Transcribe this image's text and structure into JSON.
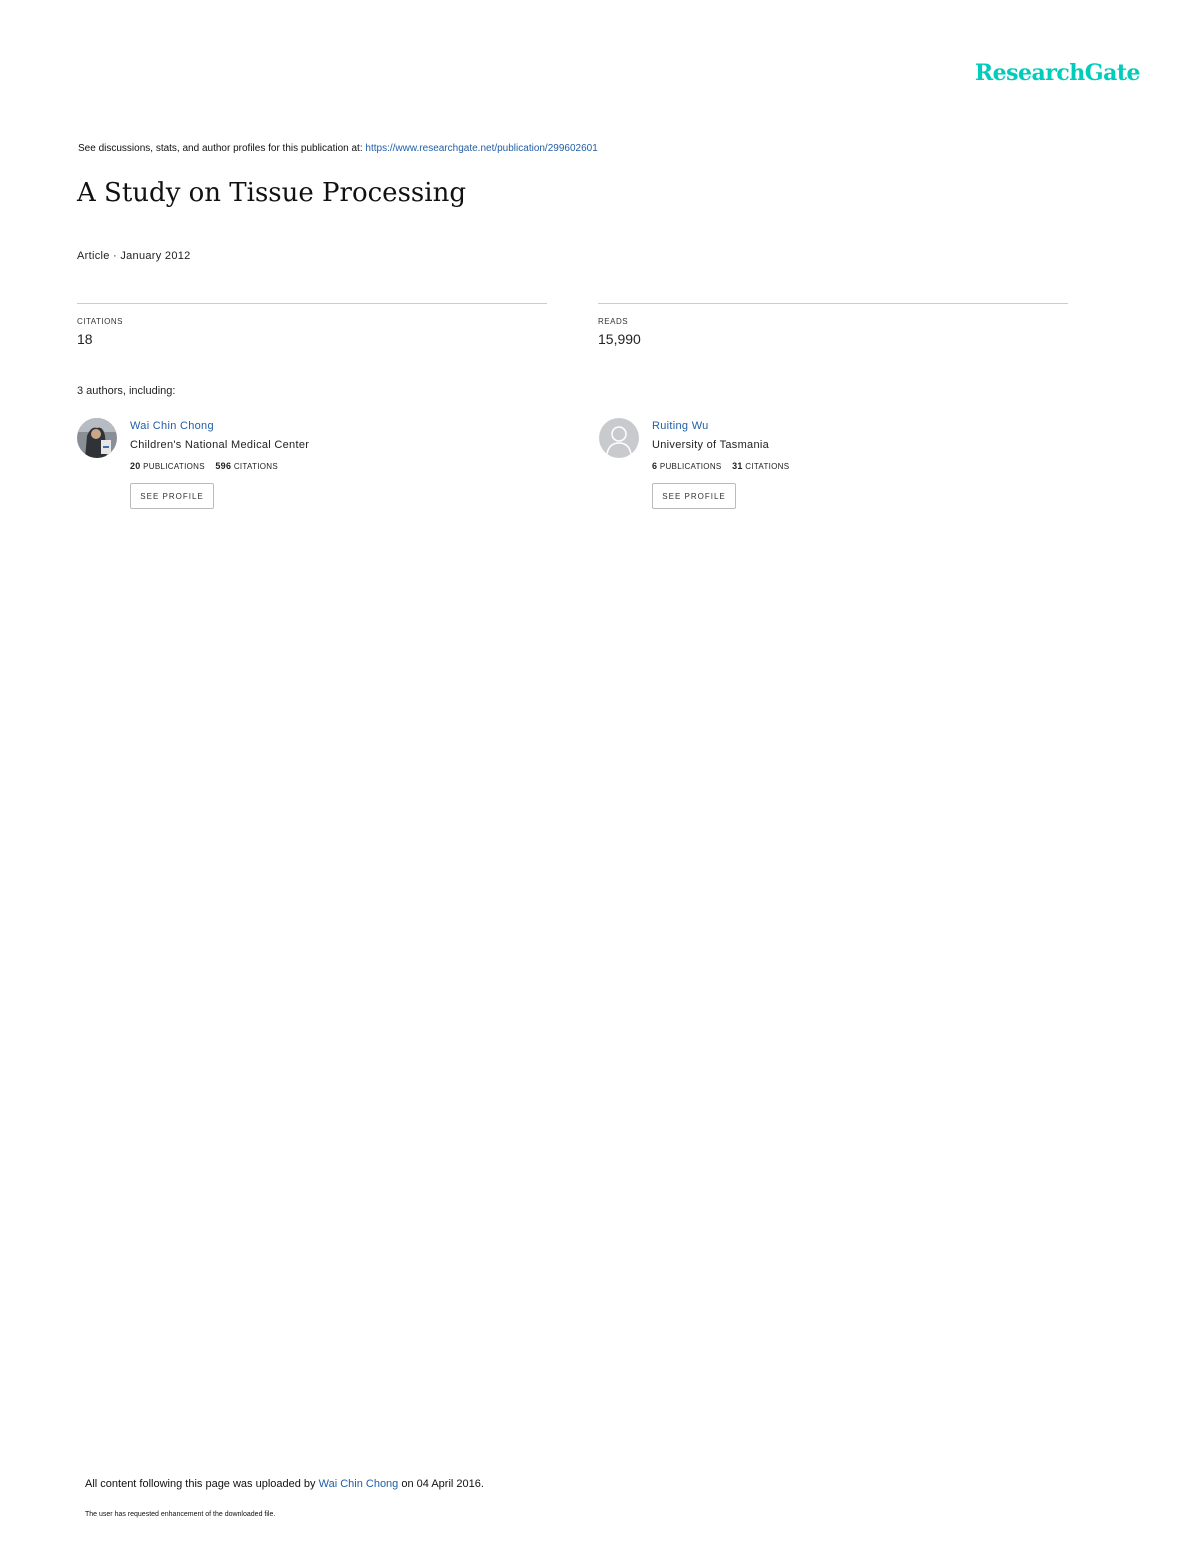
{
  "brand": {
    "name": "ResearchGate",
    "color": "#00ccbb"
  },
  "source": {
    "prefix": "See discussions, stats, and author profiles for this publication at: ",
    "url": "https://www.researchgate.net/publication/299602601"
  },
  "publication": {
    "title": "A Study on Tissue Processing",
    "meta": "Article · January 2012"
  },
  "stats": {
    "citations_label": "CITATIONS",
    "citations_value": "18",
    "reads_label": "READS",
    "reads_value": "15,990"
  },
  "authors_heading": "3 authors, including:",
  "authors": [
    {
      "name": "Wai Chin Chong",
      "institution": "Children's National Medical Center",
      "publications_count": "20",
      "publications_label": "PUBLICATIONS",
      "citations_count": "596",
      "citations_label": "CITATIONS",
      "button_label": "SEE PROFILE",
      "avatar_icon": "author-photo"
    },
    {
      "name": "Ruiting Wu",
      "institution": "University of Tasmania",
      "publications_count": "6",
      "publications_label": "PUBLICATIONS",
      "citations_count": "31",
      "citations_label": "CITATIONS",
      "button_label": "SEE PROFILE",
      "avatar_icon": "default-user-icon"
    }
  ],
  "footer": {
    "upload_prefix": "All content following this page was uploaded by ",
    "upload_author": "Wai Chin Chong",
    "upload_suffix": " on 04 April 2016.",
    "note": "The user has requested enhancement of the downloaded file."
  },
  "colors": {
    "link": "#1f5fa8",
    "divider": "#cccccc"
  }
}
